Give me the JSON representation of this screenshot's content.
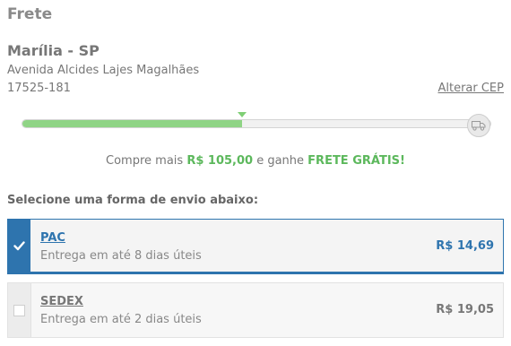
{
  "shipping": {
    "title": "Frete",
    "city": "Marília - SP",
    "street": "Avenida Alcides Lajes Magalhães",
    "cep": "17525-181",
    "change_cep_label": "Alterar CEP"
  },
  "progress": {
    "fill_percent": 47,
    "text_before": "Compre mais ",
    "amount": "R$ 105,00",
    "text_middle": " e ganhe ",
    "reward": "FRETE GRÁTIS!",
    "colors": {
      "fill": "#8fd485",
      "highlight": "#5cb85c"
    }
  },
  "select_label": "Selecione uma forma de envio abaixo:",
  "options": [
    {
      "name": "PAC",
      "description": "Entrega em até 8 dias úteis",
      "price": "R$ 14,69",
      "selected": true
    },
    {
      "name": "SEDEX",
      "description": "Entrega em até 2 dias úteis",
      "price": "R$ 19,05",
      "selected": false
    }
  ],
  "icons": {
    "progress_end": "truck-icon",
    "selected_check": "check-icon"
  },
  "colors": {
    "accent": "#2e74ae"
  }
}
